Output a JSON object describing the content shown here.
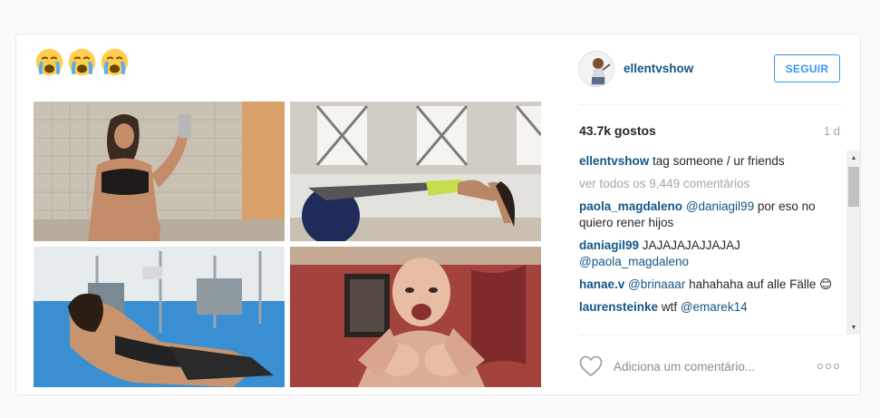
{
  "post": {
    "caption_emojis": [
      "loudly-crying-face",
      "loudly-crying-face",
      "loudly-crying-face"
    ],
    "images": [
      {
        "name": "selfie-pregnant-woman-mirror"
      },
      {
        "name": "woman-plank-on-exercise-ball"
      },
      {
        "name": "woman-gym-selfie-lying-down"
      },
      {
        "name": "muscular-baby-crying"
      }
    ]
  },
  "header": {
    "username": "ellentvshow",
    "follow_label": "SEGUIR"
  },
  "stats": {
    "likes": "43.7k gostos",
    "age": "1 d"
  },
  "caption": {
    "user": "ellentvshow",
    "text": "tag someone / ur friends"
  },
  "view_all": "ver todos os 9,449 comentários",
  "comments": [
    {
      "user": "paola_magdaleno",
      "mention": "@daniagil99",
      "text": "por eso no quiero rener hijos"
    },
    {
      "user": "daniagil99",
      "text": "JAJAJAJAJJAJAJ",
      "mention": "@paola_magdaleno"
    },
    {
      "user": "hanae.v",
      "mention": "@brinaaar",
      "text": "hahahaha auf alle Fälle 😊"
    },
    {
      "user": "laurensteinke",
      "text": "wtf",
      "mention": "@emarek14"
    }
  ],
  "footer": {
    "comment_placeholder": "Adiciona um comentário...",
    "icons": [
      "heart-icon",
      "more-options-icon"
    ]
  },
  "colors": {
    "accent": "#3897f0",
    "username": "#125688",
    "muted": "#a5a7aa"
  }
}
